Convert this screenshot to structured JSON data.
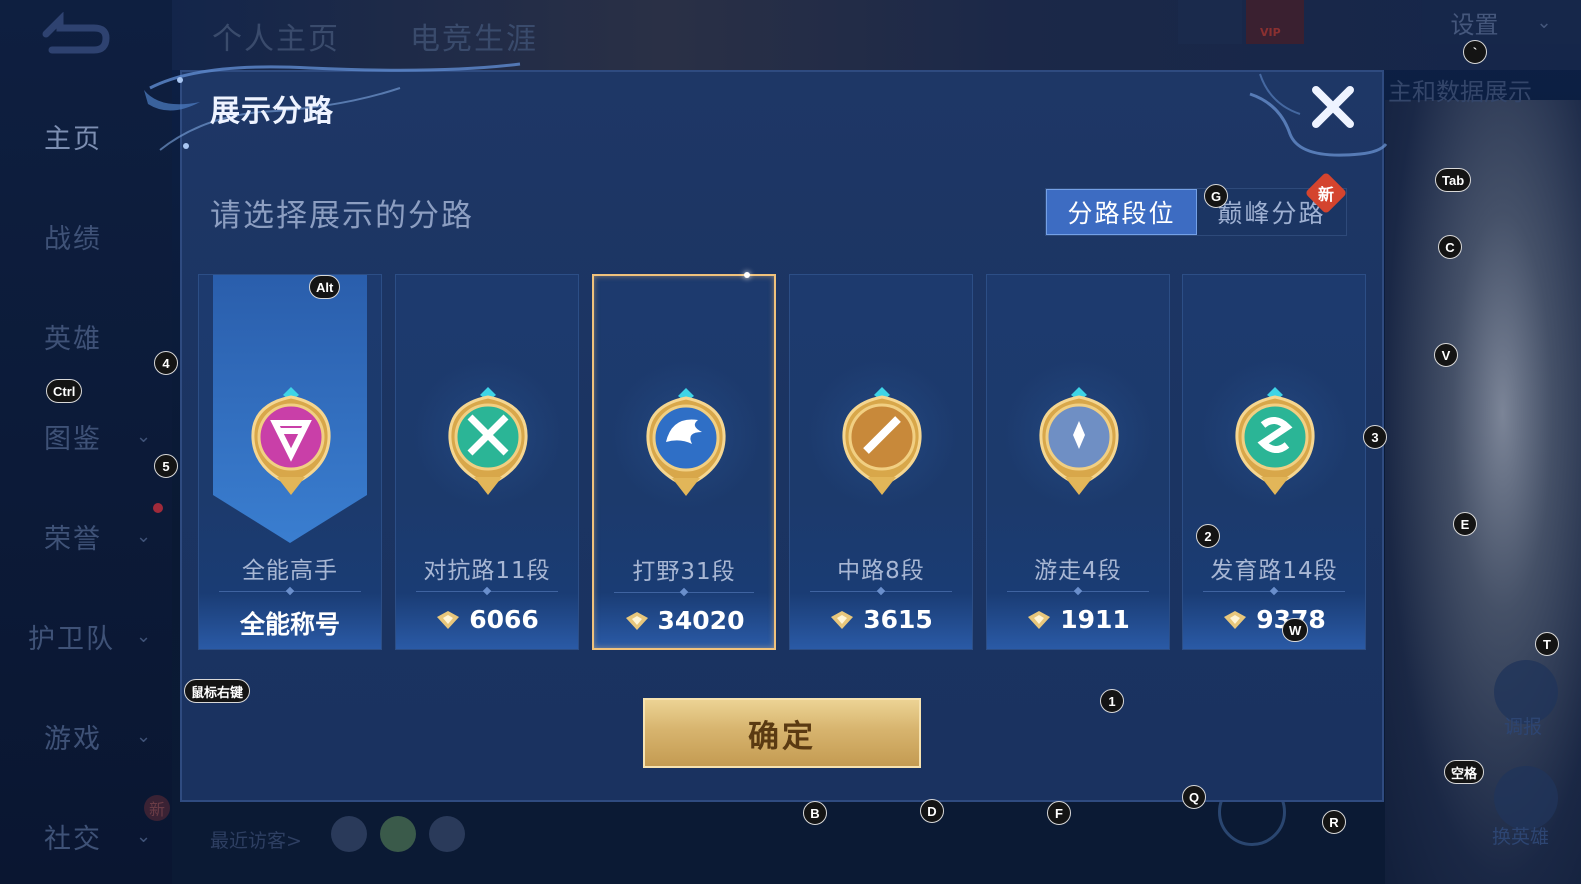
{
  "background": {
    "top_tabs": [
      "个人主页",
      "电竞生涯"
    ],
    "sidebar": [
      {
        "label": "主页",
        "active": true,
        "chevron": false
      },
      {
        "label": "战绩",
        "active": false,
        "chevron": false
      },
      {
        "label": "英雄",
        "active": false,
        "chevron": false
      },
      {
        "label": "图鉴",
        "active": false,
        "chevron": true
      },
      {
        "label": "荣誉",
        "active": false,
        "chevron": true
      },
      {
        "label": "护卫队",
        "active": false,
        "chevron": true
      },
      {
        "label": "游戏",
        "active": false,
        "chevron": true
      },
      {
        "label": "社交",
        "active": false,
        "chevron": true
      }
    ],
    "sidebar_new_badge": "新",
    "settings_label": "设置",
    "top_vip_label": "VIP",
    "data_display_text": "主和数据展示",
    "recent_visitors": "最近访客>",
    "right_tool_1": "调报",
    "right_tool_2": "换英雄"
  },
  "modal": {
    "title": "展示分路",
    "subtitle": "请选择展示的分路",
    "toggle": {
      "options": [
        "分路段位",
        "巅峰分路"
      ],
      "selected_index": 0,
      "new_badge": "新"
    },
    "cards": [
      {
        "name": "全能高手",
        "score": "全能称号",
        "score_icon": false,
        "badge_icon": "all-rounder-emblem-icon",
        "color": "#c93fa8",
        "selected": false,
        "banner": true
      },
      {
        "name": "对抗路11段",
        "score": "6066",
        "score_icon": true,
        "badge_icon": "clash-lane-emblem-icon",
        "color": "#2bb596",
        "selected": false,
        "banner": false
      },
      {
        "name": "打野31段",
        "score": "34020",
        "score_icon": true,
        "badge_icon": "jungle-dragon-emblem-icon",
        "color": "#2f6fc6",
        "selected": true,
        "banner": false
      },
      {
        "name": "中路8段",
        "score": "3615",
        "score_icon": true,
        "badge_icon": "mid-lane-emblem-icon",
        "color": "#c8893a",
        "selected": false,
        "banner": false
      },
      {
        "name": "游走4段",
        "score": "1911",
        "score_icon": true,
        "badge_icon": "roam-wings-emblem-icon",
        "color": "#6f8fc4",
        "selected": false,
        "banner": false
      },
      {
        "name": "发育路14段",
        "score": "9378",
        "score_icon": true,
        "badge_icon": "farm-lane-emblem-icon",
        "color": "#2bb596",
        "selected": false,
        "banner": false
      }
    ],
    "confirm_label": "确定"
  },
  "key_hints": [
    {
      "key": "`",
      "name": "hint-backtick"
    },
    {
      "key": "Tab",
      "name": "hint-tab"
    },
    {
      "key": "G",
      "name": "hint-g"
    },
    {
      "key": "C",
      "name": "hint-c"
    },
    {
      "key": "Alt",
      "name": "hint-alt"
    },
    {
      "key": "V",
      "name": "hint-v"
    },
    {
      "key": "4",
      "name": "hint-4"
    },
    {
      "key": "Ctrl",
      "name": "hint-ctrl"
    },
    {
      "key": "3",
      "name": "hint-3"
    },
    {
      "key": "5",
      "name": "hint-5"
    },
    {
      "key": "E",
      "name": "hint-e"
    },
    {
      "key": "2",
      "name": "hint-2"
    },
    {
      "key": "W",
      "name": "hint-w"
    },
    {
      "key": "T",
      "name": "hint-t"
    },
    {
      "key": "鼠标右键",
      "name": "hint-right-mouse"
    },
    {
      "key": "1",
      "name": "hint-1"
    },
    {
      "key": "空格",
      "name": "hint-space"
    },
    {
      "key": "Q",
      "name": "hint-q"
    },
    {
      "key": "B",
      "name": "hint-b"
    },
    {
      "key": "D",
      "name": "hint-d"
    },
    {
      "key": "F",
      "name": "hint-f"
    },
    {
      "key": "R",
      "name": "hint-r"
    }
  ]
}
